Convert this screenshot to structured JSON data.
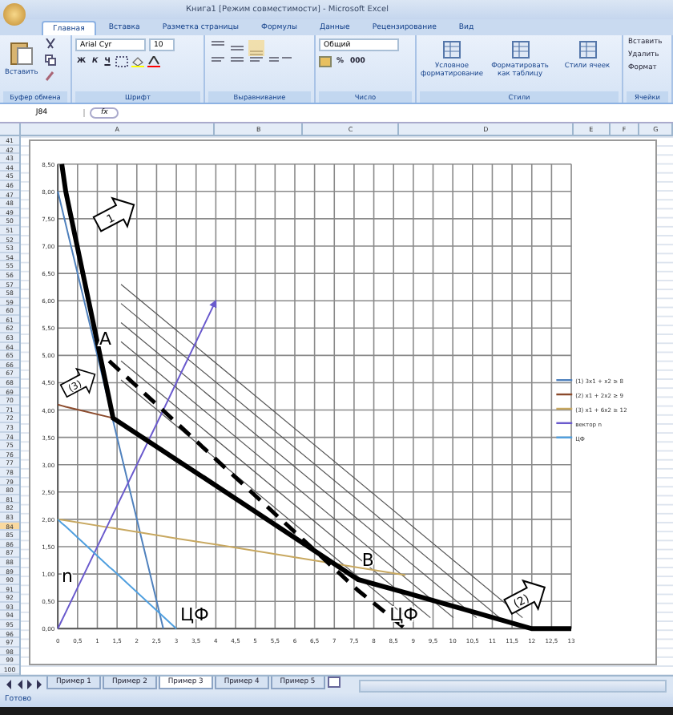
{
  "window": {
    "title": "Книга1 [Режим совместимости] - Microsoft Excel"
  },
  "tabs": [
    {
      "label": "Главная",
      "selected": true
    },
    {
      "label": "Вставка",
      "selected": false
    },
    {
      "label": "Разметка страницы",
      "selected": false
    },
    {
      "label": "Формулы",
      "selected": false
    },
    {
      "label": "Данные",
      "selected": false
    },
    {
      "label": "Рецензирование",
      "selected": false
    },
    {
      "label": "Вид",
      "selected": false
    }
  ],
  "ribbon": {
    "groups": [
      {
        "kind": "clipboard",
        "label": "Буфер обмена",
        "button": "Вставить"
      },
      {
        "kind": "font",
        "label": "Шрифт",
        "font": "Arial Cyr",
        "size": "10",
        "styles": [
          "Ж",
          "К",
          "Ч"
        ]
      },
      {
        "kind": "align",
        "label": "Выравнивание"
      },
      {
        "kind": "number",
        "label": "Число",
        "format": "Общий",
        "buttons": [
          "%",
          "000"
        ]
      },
      {
        "kind": "styles",
        "label": "Стили",
        "buttons": [
          "Условное форматирование",
          "Форматировать как таблицу",
          "Стили ячеек"
        ]
      },
      {
        "kind": "cells",
        "label": "Ячейки",
        "buttons": [
          "Вставить",
          "Удалить",
          "Формат"
        ]
      }
    ]
  },
  "formula_bar": {
    "name_box": "J84",
    "fx": "fx"
  },
  "columns": [
    {
      "label": "A"
    },
    {
      "label": "B"
    },
    {
      "label": "C"
    },
    {
      "label": "D"
    },
    {
      "label": "E"
    },
    {
      "label": "F"
    },
    {
      "label": "G"
    }
  ],
  "rows": [
    {
      "label": "41",
      "selected": false
    },
    {
      "label": "42",
      "selected": false
    },
    {
      "label": "43",
      "selected": false
    },
    {
      "label": "44",
      "selected": false
    },
    {
      "label": "45",
      "selected": false
    },
    {
      "label": "46",
      "selected": false
    },
    {
      "label": "47",
      "selected": false
    },
    {
      "label": "48",
      "selected": false
    },
    {
      "label": "49",
      "selected": false
    },
    {
      "label": "50",
      "selected": false
    },
    {
      "label": "51",
      "selected": false
    },
    {
      "label": "52",
      "selected": false
    },
    {
      "label": "53",
      "selected": false
    },
    {
      "label": "54",
      "selected": false
    },
    {
      "label": "55",
      "selected": false
    },
    {
      "label": "56",
      "selected": false
    },
    {
      "label": "57",
      "selected": false
    },
    {
      "label": "58",
      "selected": false
    },
    {
      "label": "59",
      "selected": false
    },
    {
      "label": "60",
      "selected": false
    },
    {
      "label": "61",
      "selected": false
    },
    {
      "label": "62",
      "selected": false
    },
    {
      "label": "63",
      "selected": false
    },
    {
      "label": "64",
      "selected": false
    },
    {
      "label": "65",
      "selected": false
    },
    {
      "label": "66",
      "selected": false
    },
    {
      "label": "67",
      "selected": false
    },
    {
      "label": "68",
      "selected": false
    },
    {
      "label": "69",
      "selected": false
    },
    {
      "label": "70",
      "selected": false
    },
    {
      "label": "71",
      "selected": false
    },
    {
      "label": "72",
      "selected": false
    },
    {
      "label": "73",
      "selected": false
    },
    {
      "label": "74",
      "selected": false
    },
    {
      "label": "75",
      "selected": false
    },
    {
      "label": "76",
      "selected": false
    },
    {
      "label": "77",
      "selected": false
    },
    {
      "label": "78",
      "selected": false
    },
    {
      "label": "79",
      "selected": false
    },
    {
      "label": "80",
      "selected": false
    },
    {
      "label": "81",
      "selected": false
    },
    {
      "label": "82",
      "selected": false
    },
    {
      "label": "83",
      "selected": false
    },
    {
      "label": "84",
      "selected": true
    },
    {
      "label": "85",
      "selected": false
    },
    {
      "label": "86",
      "selected": false
    },
    {
      "label": "87",
      "selected": false
    },
    {
      "label": "88",
      "selected": false
    },
    {
      "label": "89",
      "selected": false
    },
    {
      "label": "90",
      "selected": false
    },
    {
      "label": "91",
      "selected": false
    },
    {
      "label": "92",
      "selected": false
    },
    {
      "label": "93",
      "selected": false
    },
    {
      "label": "94",
      "selected": false
    },
    {
      "label": "95",
      "selected": false
    },
    {
      "label": "96",
      "selected": false
    },
    {
      "label": "97",
      "selected": false
    },
    {
      "label": "98",
      "selected": false
    },
    {
      "label": "99",
      "selected": false
    },
    {
      "label": "100",
      "selected": false
    }
  ],
  "chart": {
    "chart_data": {
      "type": "line",
      "xlim": [
        0,
        13
      ],
      "ylim": [
        0,
        8.5
      ],
      "xticks": [
        {
          "value": 0,
          "label": "0"
        },
        {
          "value": 0.5,
          "label": "0,5"
        },
        {
          "value": 1,
          "label": "1"
        },
        {
          "value": 1.5,
          "label": "1,5"
        },
        {
          "value": 2,
          "label": "2"
        },
        {
          "value": 2.5,
          "label": "2,5"
        },
        {
          "value": 3,
          "label": "3"
        },
        {
          "value": 3.5,
          "label": "3,5"
        },
        {
          "value": 4,
          "label": "4"
        },
        {
          "value": 4.5,
          "label": "4,5"
        },
        {
          "value": 5,
          "label": "5"
        },
        {
          "value": 5.5,
          "label": "5,5"
        },
        {
          "value": 6,
          "label": "6"
        },
        {
          "value": 6.5,
          "label": "6,5"
        },
        {
          "value": 7,
          "label": "7"
        },
        {
          "value": 7.5,
          "label": "7,5"
        },
        {
          "value": 8,
          "label": "8"
        },
        {
          "value": 8.5,
          "label": "8,5"
        },
        {
          "value": 9,
          "label": "9"
        },
        {
          "value": 9.5,
          "label": "9,5"
        },
        {
          "value": 10,
          "label": "10"
        },
        {
          "value": 10.5,
          "label": "10,5"
        },
        {
          "value": 11,
          "label": "11"
        },
        {
          "value": 11.5,
          "label": "11,5"
        },
        {
          "value": 12,
          "label": "12"
        },
        {
          "value": 12.5,
          "label": "12,5"
        },
        {
          "value": 13,
          "label": "13"
        }
      ],
      "yticks": [
        {
          "value": 0,
          "label": "0,00"
        },
        {
          "value": 0.5,
          "label": "0,50"
        },
        {
          "value": 1,
          "label": "1,00"
        },
        {
          "value": 1.5,
          "label": "1,50"
        },
        {
          "value": 2,
          "label": "2,00"
        },
        {
          "value": 2.5,
          "label": "2,50"
        },
        {
          "value": 3,
          "label": "3,00"
        },
        {
          "value": 3.5,
          "label": "3,50"
        },
        {
          "value": 4,
          "label": "4,00"
        },
        {
          "value": 4.5,
          "label": "4,50"
        },
        {
          "value": 5,
          "label": "5,00"
        },
        {
          "value": 5.5,
          "label": "5,50"
        },
        {
          "value": 6,
          "label": "6,00"
        },
        {
          "value": 6.5,
          "label": "6,50"
        },
        {
          "value": 7,
          "label": "7,00"
        },
        {
          "value": 7.5,
          "label": "7,50"
        },
        {
          "value": 8,
          "label": "8,00"
        },
        {
          "value": 8.5,
          "label": "8,50"
        }
      ],
      "x": [
        0,
        0.1,
        0.2,
        1.3,
        1.4,
        2.67,
        3,
        4,
        7.6,
        8.8,
        12,
        13
      ],
      "series": [
        {
          "name": "(1) 3x1 + x2 ≥ 8",
          "color": "#4f81bd",
          "values": [
            8,
            7.7,
            7.4,
            4.1,
            3.8,
            0,
            null,
            null,
            null,
            null,
            null,
            null
          ]
        },
        {
          "name": "(2) x1 + 2x2 ≥ 9",
          "color": "#8b4a2b",
          "values": [
            4.1,
            4.08,
            4.06,
            3.87,
            3.85,
            null,
            null,
            null,
            null,
            null,
            null,
            null
          ]
        },
        {
          "name": "(3) x1 + 6x2 ≥ 12",
          "color": "#c8a860",
          "values": [
            2,
            1.99,
            1.98,
            1.85,
            1.84,
            1.69,
            1.65,
            1.54,
            1.12,
            0.98,
            null,
            null
          ]
        },
        {
          "name": "вектор n",
          "color": "#6a5acd",
          "values": [
            0,
            0.15,
            0.3,
            1.95,
            2.1,
            4,
            4.5,
            6,
            null,
            null,
            null,
            null
          ]
        },
        {
          "name": "ЦФ",
          "color": "#4f9fdf",
          "values": [
            2,
            1.93,
            1.87,
            1.13,
            1.07,
            0.22,
            0,
            null,
            null,
            null,
            null,
            null
          ]
        },
        {
          "color": "#000000",
          "values": [
            null,
            8.5,
            8,
            4.2,
            3.85,
            3.25,
            3.09,
            2.62,
            0.9,
            0.66,
            0,
            0
          ]
        },
        {
          "color": "#000000",
          "line_style": "dashed",
          "values": [
            null,
            null,
            null,
            4.9,
            4.83,
            3.99,
            3.77,
            3.1,
            0.7,
            0,
            null,
            null
          ]
        }
      ],
      "grid": true,
      "legend": true,
      "annotations": [
        "A",
        "B",
        "n",
        "ЦФ",
        "ЦФ"
      ]
    },
    "series_styles": [
      {
        "kind": "thin"
      },
      {
        "kind": "thin"
      },
      {
        "kind": "thin"
      },
      {
        "kind": "arrow"
      },
      {
        "kind": "thin"
      },
      {
        "kind": "thick"
      },
      {
        "kind": "thick"
      }
    ],
    "callouts": [
      {
        "text": "1"
      },
      {
        "text": "(3)"
      },
      {
        "text": "(2)"
      }
    ]
  },
  "sheet_tabs": [
    {
      "label": "Пример 1",
      "selected": false
    },
    {
      "label": "Пример 2",
      "selected": false
    },
    {
      "label": "Пример 3",
      "selected": true
    },
    {
      "label": "Пример 4",
      "selected": false
    },
    {
      "label": "Пример 5",
      "selected": false
    }
  ],
  "status_bar": {
    "text": "Готово"
  }
}
